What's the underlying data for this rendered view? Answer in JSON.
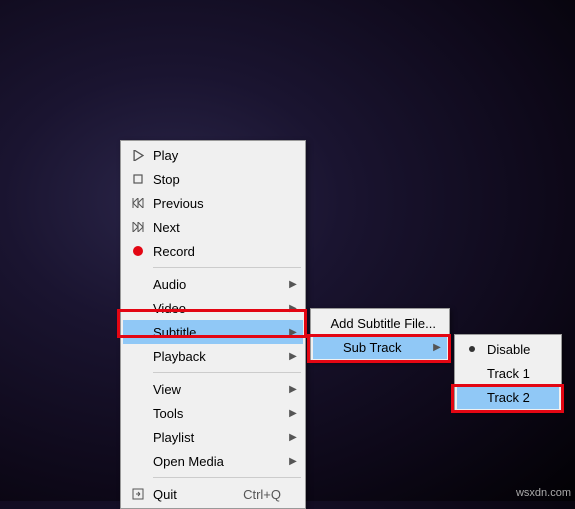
{
  "main_menu": {
    "play": "Play",
    "stop": "Stop",
    "previous": "Previous",
    "next": "Next",
    "record": "Record",
    "audio": "Audio",
    "video": "Video",
    "subtitle": "Subtitle",
    "playback": "Playback",
    "view": "View",
    "tools": "Tools",
    "playlist": "Playlist",
    "open_media": "Open Media",
    "quit": "Quit",
    "quit_shortcut": "Ctrl+Q"
  },
  "subtitle_menu": {
    "add_subtitle_file": "Add Subtitle File...",
    "sub_track": "Sub Track"
  },
  "sub_track_menu": {
    "disable": "Disable",
    "track1": "Track 1",
    "track2": "Track 2"
  },
  "watermark": "wsxdn.com"
}
